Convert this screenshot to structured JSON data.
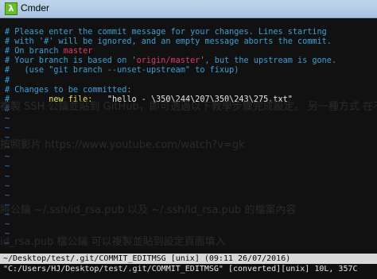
{
  "window": {
    "title": "Cmder",
    "icon": "lambda-icon"
  },
  "editor": {
    "lines": [
      "",
      "# Please enter the commit message for your changes. Lines starting",
      "# with '#' will be ignored, and an empty message aborts the commit.",
      "# On branch ",
      "# Your branch is based on '",
      "#   (use \"git branch --unset-upstream\" to fixup)",
      "#",
      "# Changes to be committed:",
      "#\t",
      "#"
    ],
    "branch": "master",
    "upstream": "origin/master",
    "upstream_suffix": "', but the upstream is gone.",
    "new_file_label": "new file:",
    "new_file_path": "\"hello - \\350\\244\\207\\350\\243\\275.txt\"",
    "tilde_count": 14,
    "tilde_char": "~"
  },
  "ghost_text": [
    "複製 SSH 公鑰並貼到 GitHub，即可透過以下教學步驟完成設定。 另一種方式 在不同",
    "按照影片 https://www.youtube.com/watch?v=gk",
    "將公鑰 ~/.ssh/id_rsa.pub 以及 ~/.ssh/id_rsa.pub 的檔案內容",
    "id_rsa.pub 檔公鑰 可以複製並貼到設定頁面填入"
  ],
  "status_bar": {
    "text": "~/Desktop/test/.git/COMMIT_EDITMSG [unix] (09:11 26/07/2016)"
  },
  "command_line": {
    "text": "\"C:/Users/HJ/Desktop/test/.git/COMMIT_EDITMSG\" [converted][unix] 10L, 357C"
  },
  "colors": {
    "comment": "#3aa0d6",
    "branch": "#e0386a",
    "new_file": "#e5e544",
    "tilde": "#2f78d0",
    "status_bg": "#d8d8d8"
  }
}
